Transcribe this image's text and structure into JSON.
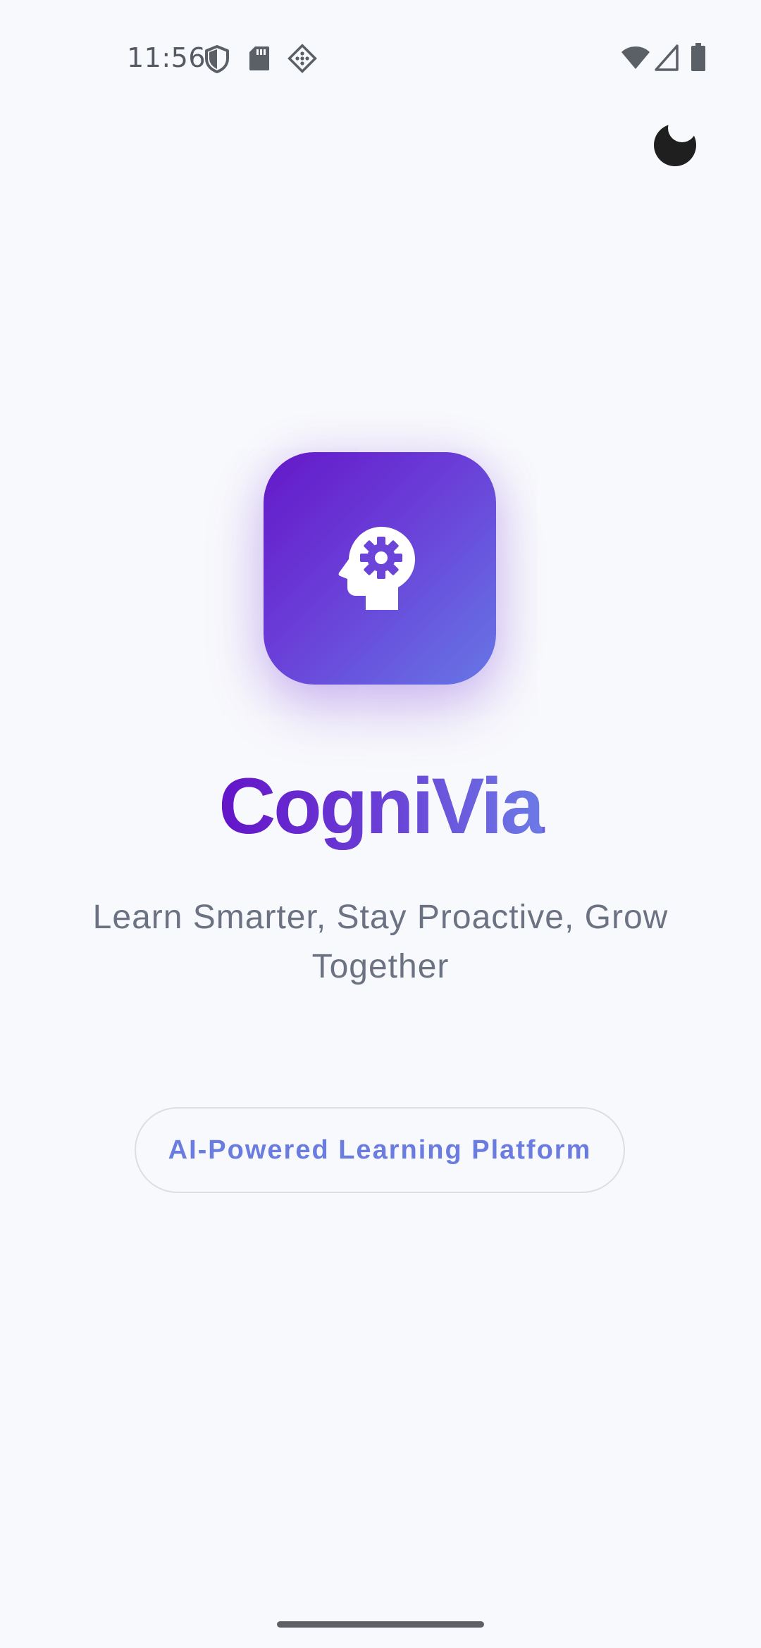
{
  "status_bar": {
    "time": "11:56",
    "left_icons": [
      "vpn-shield-icon",
      "sd-card-icon",
      "app-notification-icon"
    ],
    "right_icons": [
      "wifi-icon",
      "cell-signal-icon",
      "battery-icon"
    ]
  },
  "header": {
    "theme_toggle_icon": "moon-icon"
  },
  "splash": {
    "logo_icon": "head-gear-icon",
    "app_name": "CogniVia",
    "tagline": "Learn Smarter, Stay Proactive, Grow Together",
    "badge_label": "AI-Powered Learning Platform"
  },
  "colors": {
    "background": "#f8f9fc",
    "brand_gradient_start": "#6418c8",
    "brand_gradient_end": "#6677e6",
    "tagline_text": "#6b7282",
    "badge_text": "#6a7ce0",
    "badge_border": "#dcdee3"
  }
}
